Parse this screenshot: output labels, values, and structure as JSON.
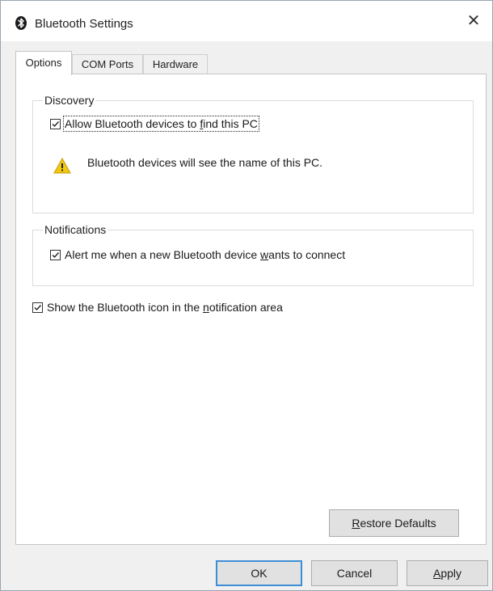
{
  "window": {
    "title": "Bluetooth Settings",
    "close_glyph": "✕"
  },
  "tabs": [
    {
      "label": "Options",
      "active": true
    },
    {
      "label": "COM Ports",
      "active": false
    },
    {
      "label": "Hardware",
      "active": false
    }
  ],
  "discovery": {
    "legend": "Discovery",
    "allow_checkbox": {
      "label_before": "Allow Bluetooth devices to ",
      "label_accel": "f",
      "label_after": "ind this PC",
      "checked": true
    },
    "warning_text": "Bluetooth devices will see the name of this PC."
  },
  "notifications": {
    "legend": "Notifications",
    "alert_checkbox": {
      "label_before": "Alert me when a new Bluetooth device ",
      "label_accel": "w",
      "label_after": "ants to connect",
      "checked": true
    }
  },
  "show_icon_checkbox": {
    "label_before": "Show the Bluetooth icon in the ",
    "label_accel": "n",
    "label_after": "otification area",
    "checked": true
  },
  "buttons": {
    "restore_defaults": {
      "before": "",
      "accel": "R",
      "after": "estore Defaults"
    },
    "ok": "OK",
    "cancel": "Cancel",
    "apply": {
      "before": "",
      "accel": "A",
      "after": "pply"
    }
  },
  "colors": {
    "accent_border": "#3c8fd6",
    "bluetooth_logo": "#1b1b1b",
    "warning_fill": "#f2c811"
  }
}
